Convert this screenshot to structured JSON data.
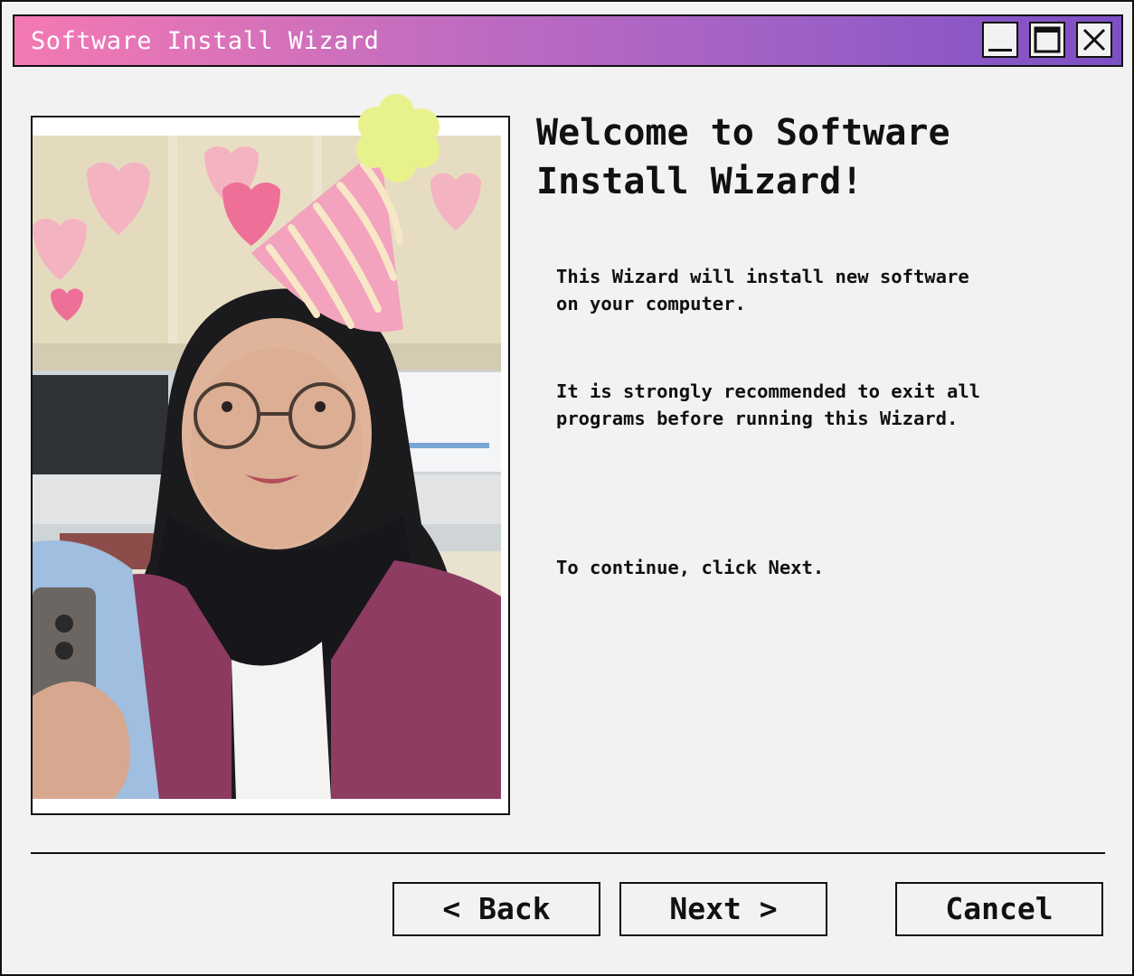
{
  "window": {
    "title": "Software Install Wizard",
    "controls": {
      "minimize": "minimize-icon",
      "maximize": "maximize-icon",
      "close": "close-icon"
    }
  },
  "main": {
    "heading": "Welcome to Software Install Wizard!",
    "paragraphs": [
      "This Wizard will install new software\non your computer.",
      "It is strongly recommended to exit all\nprograms before running this Wizard.",
      "To continue, click Next."
    ]
  },
  "buttons": {
    "back": "< Back",
    "next": "Next >",
    "cancel": "Cancel"
  },
  "colors": {
    "titlebar_start": "#f479b2",
    "titlebar_end": "#7c4fc4",
    "window_bg": "#f2f2f2",
    "hat_pink": "#f3a3bd",
    "hat_stripes": "#f8e7c6",
    "hat_pompom": "#e8f28c"
  }
}
